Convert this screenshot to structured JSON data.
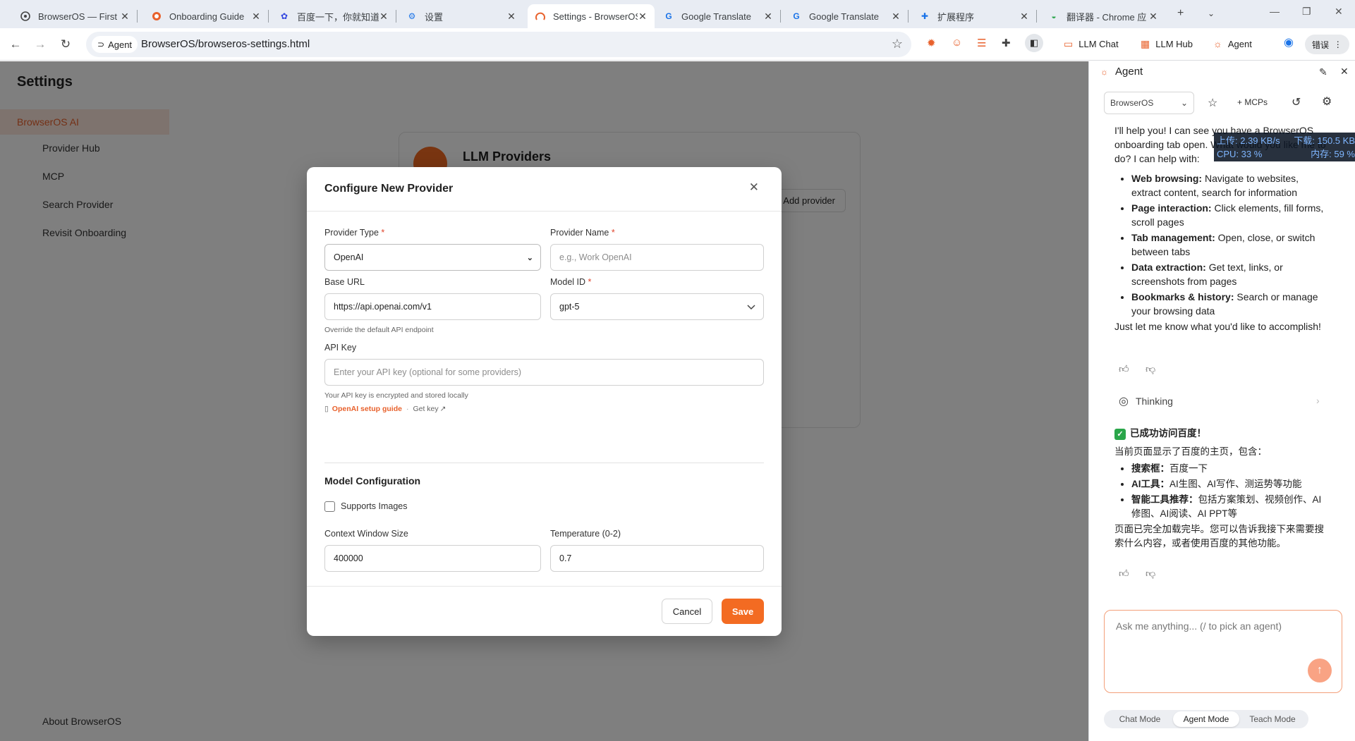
{
  "browser": {
    "tabs": [
      {
        "label": "BrowserOS — First",
        "icon": "browseros-icon",
        "active": false
      },
      {
        "label": "Onboarding Guide",
        "icon": "github-icon",
        "active": false
      },
      {
        "label": "百度一下，你就知道",
        "icon": "baidu-icon",
        "active": false
      },
      {
        "label": "设置",
        "icon": "settings-icon",
        "active": false
      },
      {
        "label": "Settings - BrowserOS",
        "icon": "browseros-icon",
        "active": true
      },
      {
        "label": "Google Translate",
        "icon": "translate-icon",
        "active": false
      },
      {
        "label": "Google Translate",
        "icon": "translate-icon",
        "active": false
      },
      {
        "label": "扩展程序",
        "icon": "puzzle-icon",
        "active": false
      },
      {
        "label": "翻译器 - Chrome 应",
        "icon": "chrome-web-store-icon",
        "active": false
      }
    ],
    "new_tab": "+",
    "address": {
      "chip_label": "Agent",
      "url": "BrowserOS/browseros-settings.html"
    },
    "toolbar": {
      "llm_chat": "LLM Chat",
      "llm_hub": "LLM Hub",
      "agent": "Agent",
      "error_pill": "错误"
    }
  },
  "settings_page": {
    "title": "Settings",
    "nav": [
      "BrowserOS AI",
      "Provider Hub",
      "MCP",
      "Search Provider",
      "Revisit Onboarding"
    ],
    "footer": "About BrowserOS",
    "card_title": "LLM Providers",
    "add_provider": "+ Add provider"
  },
  "modal": {
    "title": "Configure New Provider",
    "provider_type_label": "Provider Type",
    "provider_type_value": "OpenAI",
    "provider_name_label": "Provider Name",
    "provider_name_placeholder": "e.g., Work OpenAI",
    "base_url_label": "Base URL",
    "base_url_value": "https://api.openai.com/v1",
    "base_url_hint": "Override the default API endpoint",
    "model_id_label": "Model ID",
    "model_id_value": "gpt-5",
    "api_key_label": "API Key",
    "api_key_placeholder": "Enter your API key (optional for some providers)",
    "api_key_hint": "Your API key is encrypted and stored locally",
    "setup_guide": "OpenAI setup guide",
    "get_key": "Get key",
    "section_title": "Model Configuration",
    "supports_images": "Supports Images",
    "context_window_label": "Context Window Size",
    "context_window_value": "400000",
    "temperature_label": "Temperature (0-2)",
    "temperature_value": "0.7",
    "cancel": "Cancel",
    "save": "Save",
    "required_mark": "*"
  },
  "agent_panel": {
    "title": "Agent",
    "agent_select": "BrowserOS",
    "mcps": "+ MCPs",
    "message1_intro": "I'll help you! I can see you have a BrowserOS onboarding tab open. What would you like me to do? I can help with:",
    "capabilities": [
      {
        "bold": "Web browsing:",
        "text": " Navigate to websites, extract content, search for information"
      },
      {
        "bold": "Page interaction:",
        "text": " Click elements, fill forms, scroll pages"
      },
      {
        "bold": "Tab management:",
        "text": " Open, close, or switch between tabs"
      },
      {
        "bold": "Data extraction:",
        "text": " Get text, links, or screenshots from pages"
      },
      {
        "bold": "Bookmarks & history:",
        "text": " Search or manage your browsing data"
      }
    ],
    "message1_outro": "Just let me know what you'd like to accomplish!",
    "thinking": "Thinking",
    "message2_title": "已成功访问百度！",
    "message2_intro": "当前页面显示了百度的主页，包含：",
    "message2_items": [
      {
        "bold": "搜索框：",
        "text": "百度一下"
      },
      {
        "bold": "AI工具：",
        "text": "AI生图、AI写作、测运势等功能"
      },
      {
        "bold": "智能工具推荐：",
        "text": "包括方案策划、视频创作、AI修图、AI阅读、AI PPT等"
      }
    ],
    "message2_outro": "页面已完全加载完毕。您可以告诉我接下来需要搜索什么内容，或者使用百度的其他功能。",
    "input_placeholder": "Ask me anything... (/ to pick an agent)",
    "modes": [
      "Chat Mode",
      "Agent Mode",
      "Teach Mode"
    ],
    "active_mode": "Agent Mode"
  },
  "net_meter": {
    "upload": "上传: 2.39 KB/s",
    "download": "下载: 150.5 KB",
    "cpu": "CPU: 33 %",
    "memory": "内存: 59 %"
  },
  "colors": {
    "accent": "#f36b22",
    "link": "#e8612c",
    "required": "#e0452c"
  }
}
